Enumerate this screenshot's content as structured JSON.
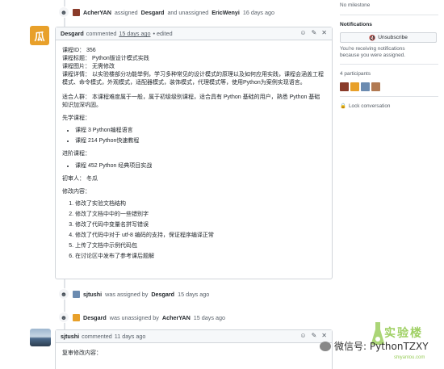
{
  "events": {
    "first": {
      "actor": "AcherYAN",
      "action1": "assigned",
      "target1": "Desgard",
      "action2": "and unassigned",
      "target2": "EricWenyi",
      "time": "16 days ago"
    },
    "labeled": {
      "actor": "sjtushi",
      "action": "was assigned by",
      "target": "Desgard",
      "time": "15 days ago"
    },
    "unassigned": {
      "actor": "Desgard",
      "action": "was unassigned by",
      "target": "AcherYAN",
      "time": "15 days ago"
    }
  },
  "comment1": {
    "author": "Desgard",
    "verb": "commented",
    "time": "15 days ago",
    "edited": "• edited",
    "avatar_glyph": "瓜",
    "lines": {
      "course_id": "课程ID： 356",
      "course_title": "课程标题： Python版设计模式实践",
      "course_image": "课程图片： 无需修改",
      "course_detail": "课程详情： 以实验楼部分功能举例，学习多种常见的设计模式的原理以及如何应用实践，课程会涵盖工程模式、命令模式，外观模式，适配器模式，装饰模式，代理模式等，使用Python为案例实现语言。",
      "audience": "适合人群： 本课程难度属于一般，属于初级级别课程，适合具有 Python 基础的用户，熟悉 Python 基础知识加深巩固。",
      "prereq_title": "先学课程：",
      "prereq_items": [
        "课程 3 Python编程语言",
        "课程 214 Python快速教程"
      ],
      "advanced_title": "进阶课程：",
      "advanced_items": [
        "课程 452 Python 经典项目实战"
      ],
      "reviewer": "初审人： 冬瓜",
      "changes_title": "修改内容：",
      "changes_items": [
        "修改了实验文档结构",
        "修改了文档中中的一些错别字",
        "修改了代码中变量名拼写错误",
        "修改了代码中对于 utf-8 编码的支持，保证程序编译正常",
        "上传了文档中示例代码包",
        "在讨论区中发布了参考课后题解"
      ]
    }
  },
  "comment2": {
    "author": "sjtushi",
    "verb": "commented",
    "time": "11 days ago",
    "body_first_line": "复审修改内容："
  },
  "sidebar": {
    "milestone": "No milestone",
    "notifications_heading": "Notifications",
    "unsubscribe_label": "Unsubscribe",
    "notif_reason_1": "You're receiving notifications",
    "notif_reason_2": "because you were assigned.",
    "participants_label": "4 participants",
    "lock_label": "Lock conversation"
  },
  "watermark": {
    "wechat_text": "微信号: PythonTZXY",
    "brand": "实验楼",
    "domain": "shiyanlou.com"
  },
  "colors": {
    "accent_link": "#0366d6",
    "border": "#d1d5da",
    "header_bg": "#f6f8fa",
    "desgard_avatar": "#e8a02a",
    "watermark_green": "#8fc84a"
  }
}
